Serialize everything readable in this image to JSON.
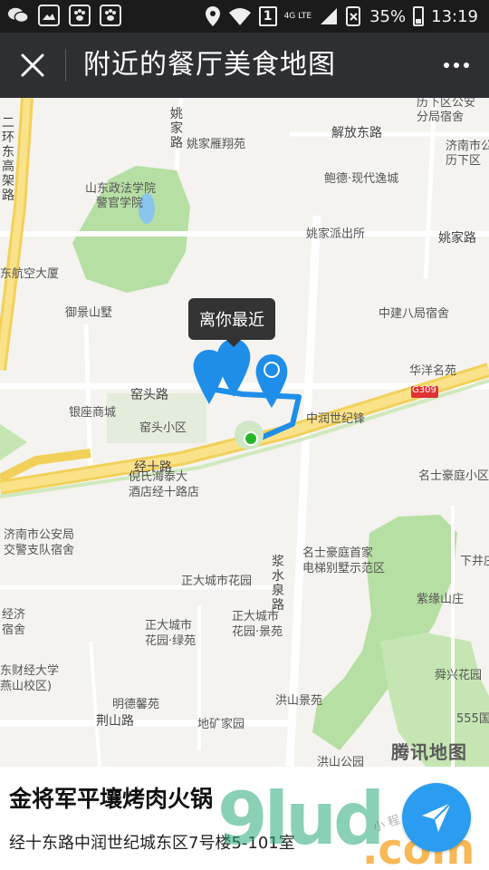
{
  "status_bar": {
    "network": "4G LTE",
    "sim_badge": "1",
    "battery": "35%",
    "time": "13:19"
  },
  "title_bar": {
    "title": "附近的餐厅美食地图"
  },
  "map": {
    "tooltip": "离你最近",
    "provider_logo": "腾讯地图",
    "roads": [
      "二环东高架路",
      "解放东路",
      "姚家路",
      "窑头路",
      "经十路",
      "浆水泉路",
      "荆山路"
    ],
    "labels": [
      {
        "text": "山东政法学院"
      },
      {
        "text": "警官学院"
      },
      {
        "text": "东航空大厦"
      },
      {
        "text": "御景山墅"
      },
      {
        "text": "姚家雁翔苑"
      },
      {
        "text": "鲍德·现代逸城"
      },
      {
        "text": "姚家派出所"
      },
      {
        "text": "中建八局宿舍"
      },
      {
        "text": "华洋名苑"
      },
      {
        "text": "中润世纪锋"
      },
      {
        "text": "银座商城"
      },
      {
        "text": "窑头小区"
      },
      {
        "text": "倪氏海泰大"
      },
      {
        "text": "酒店经十路店"
      },
      {
        "text": "名士豪庭小区"
      },
      {
        "text": "济南市公安局"
      },
      {
        "text": "交警支队宿舍"
      },
      {
        "text": "名士豪庭首家"
      },
      {
        "text": "电梯别墅示范区"
      },
      {
        "text": "正大城市花园"
      },
      {
        "text": "正大城市"
      },
      {
        "text": "花园·景苑"
      },
      {
        "text": "花园·绿苑"
      },
      {
        "text": "紫缘山庄"
      },
      {
        "text": "舜兴花园"
      },
      {
        "text": "经济"
      },
      {
        "text": "宿舍"
      },
      {
        "text": "东财经大学"
      },
      {
        "text": "燕山校区)"
      },
      {
        "text": "明德馨苑"
      },
      {
        "text": "洪山景苑"
      },
      {
        "text": "地矿家园"
      },
      {
        "text": "洪山公园"
      },
      {
        "text": "555国"
      },
      {
        "text": "下井庄"
      },
      {
        "text": "历下区公安"
      },
      {
        "text": "分局宿舍"
      },
      {
        "text": "济南市公"
      },
      {
        "text": "历下区"
      },
      {
        "text": "G309"
      }
    ]
  },
  "restaurant": {
    "name": "金将军平壤烤肉火锅",
    "address": "经十东路中润世纪城东区7号楼5-101室"
  },
  "watermark": {
    "main": "9lud",
    "com": ".com",
    "small": "小 程 序 商 店"
  },
  "icons": [
    "wechat-icon",
    "image-icon",
    "baidu-paw-icon",
    "location-icon",
    "wifi-icon",
    "signal-icon",
    "battery-icon",
    "close-icon",
    "more-icon",
    "navigate-icon"
  ]
}
